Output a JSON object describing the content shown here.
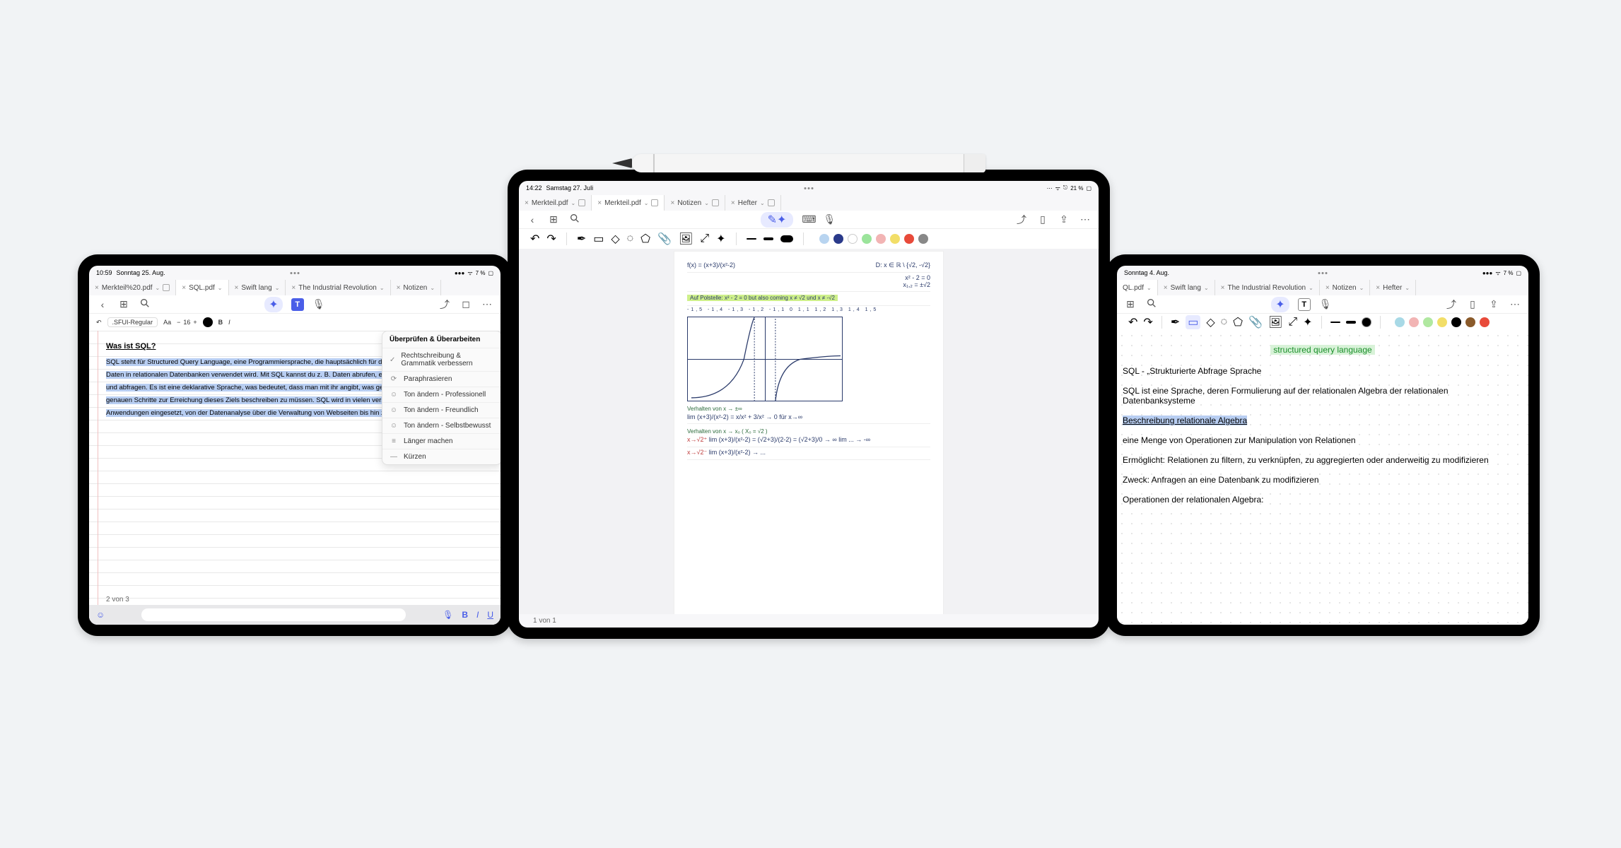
{
  "pencil": {
    "name": "apple-pencil"
  },
  "left": {
    "status": {
      "time": "10:59",
      "date": "Sonntag 25. Aug.",
      "battery_pct": "7 %"
    },
    "tabs": [
      {
        "label": "Merkteil%20.pdf"
      },
      {
        "label": "SQL.pdf",
        "active": true
      },
      {
        "label": "Swift lang"
      },
      {
        "label": "The Industrial Revolution"
      },
      {
        "label": "Notizen"
      }
    ],
    "fmt": {
      "font": ".SFUI-Regular",
      "size": "16",
      "minus": "−",
      "plus": "+",
      "bold": "B",
      "italic": "I",
      "aa": "Aa"
    },
    "doc": {
      "heading": "Was ist SQL?",
      "body": "SQL steht für Structured Query Language, eine Programmiersprache, die hauptsächlich für das Managen und Abfragen von Daten in relationalen Datenbanken verwendet wird. Mit SQL kannst du z. B. Daten abrufen, einfügen, löschen, aktualisieren und abfragen. Es ist eine deklarative Sprache, was bedeutet, dass man mit ihr angibt, was gemacht werden soll, ohne die genauen Schritte zur Erreichung dieses Ziels beschreiben zu müssen. SQL wird in vielen verschiedenen Branchen und Anwendungen eingesetzt, von der Datenanalyse über die Verwaltung von Webseiten bis hin zu Finanztransaktionen."
    },
    "menu": {
      "title": "Überprüfen & Überarbeiten",
      "items": [
        {
          "icon": "✓",
          "label": "Rechtschreibung & Grammatik verbessern"
        },
        {
          "icon": "⟳",
          "label": "Paraphrasieren"
        },
        {
          "icon": "☺",
          "label": "Ton ändern - Professionell"
        },
        {
          "icon": "☺",
          "label": "Ton ändern - Freundlich"
        },
        {
          "icon": "☺",
          "label": "Ton ändern - Selbstbewusst"
        },
        {
          "icon": "≡",
          "label": "Länger machen"
        },
        {
          "icon": "—",
          "label": "Kürzen"
        }
      ]
    },
    "page_num": "2 von  3",
    "kbd": {
      "bold": "B",
      "italic": "I",
      "underline": "U"
    }
  },
  "center": {
    "status": {
      "time": "14:22",
      "date": "Samstag 27. Juli",
      "battery": "21 %"
    },
    "tabs": [
      {
        "label": "Merkteil.pdf"
      },
      {
        "label": "Merkteil.pdf",
        "active": true
      },
      {
        "label": "Notizen"
      },
      {
        "label": "Hefter"
      }
    ],
    "colors": [
      "#b8d4f0",
      "#2a3a8a",
      "#fff",
      "#9be49b",
      "#f2b4b4",
      "#f2de68",
      "#e84a3a",
      "#888"
    ],
    "page_num": "1 von  1",
    "hw": {
      "top_l": "f(x) = (x+3)/(x²-2)",
      "top_r": "D: x ∈ ℝ \\ {√2, -√2}",
      "r2a": "x² - 2 = 0",
      "r2b": "x₁,₂ = ±√2",
      "highlight": "Auf Polstelle: x² - 2 = 0  but also coming x ≠ √2  und x ≠ -√2",
      "axis": "-1,5  -1,4  -1,3  -1,2  -1,1   0   1,1   1,2   1,3   1,4   1,5",
      "sect1": "Verhalten von x → ±∞",
      "s1a": "lim (x+3)/(x²-2) = x/x² + 3/x² → 0  für x→∞",
      "sect2": "Verhalten von x → x₀ ( X₀ = √2 )",
      "s2a": "lim (x+3)/(x²-2) = (√2+3)/(2-2) = (√2+3)/0 → ∞  lim ... → -∞",
      "s2b": "lim (x+3)/(x²-2) → ...",
      "s2a_tag": "x→√2⁺",
      "s2b_tag": "x→√2⁻"
    }
  },
  "right": {
    "status": {
      "time": "",
      "date": "Sonntag 4. Aug.",
      "battery_pct": "7 %"
    },
    "tabs": [
      {
        "label": "QL.pdf",
        "active": true
      },
      {
        "label": "Swift lang"
      },
      {
        "label": "The Industrial Revolution"
      },
      {
        "label": "Notizen"
      },
      {
        "label": "Hefter"
      }
    ],
    "colors": [
      "#a8d9e6",
      "#f2b4b4",
      "#b0e8a0",
      "#f2de68",
      "#000",
      "#8a5a2a",
      "#e84a3a"
    ],
    "doc": {
      "title": "structured query language",
      "l1": "SQL - „Strukturierte Abfrage Sprache",
      "l2": "SQL ist eine Sprache, deren Formulierung auf der relationalen Algebra der relationalen Datenbanksysteme",
      "h2": "Beschreibung relationale Algebra",
      "l3": "eine Menge von Operationen zur Manipulation von Relationen",
      "l4": "Ermöglicht: Relationen zu filtern, zu verknüpfen, zu aggregierten oder anderweitig zu modifizieren",
      "l5": "Zweck: Anfragen an eine Datenbank zu modifizieren",
      "l6": "Operationen der relationalen Algebra:"
    }
  }
}
